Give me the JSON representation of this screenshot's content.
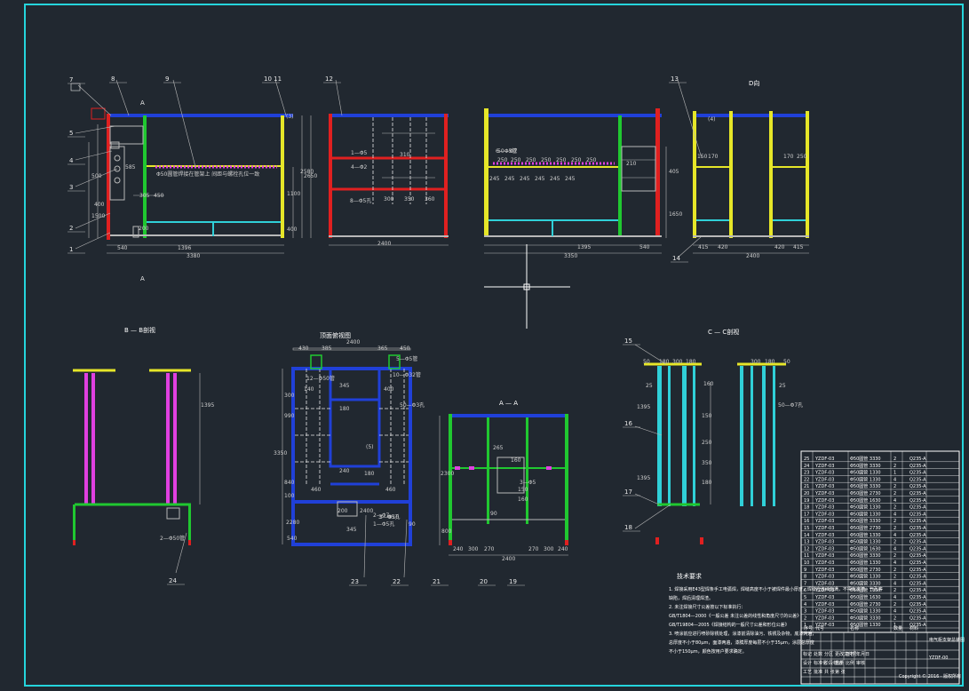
{
  "colors": {
    "background": "#212830",
    "border": "#25d5dc",
    "white": "#ffffff",
    "blue": "#2040d8",
    "red": "#e02020",
    "yellow": "#e6e628",
    "green": "#20c830",
    "cyan": "#30d0d8",
    "magenta": "#e040e0",
    "grey": "#b8b8b8"
  },
  "icons": [
    "crosshair-cursor-icon"
  ],
  "view_titles": {
    "section_b": "B — B剖视",
    "top_view_plan": "顶面俯视图",
    "section_a": "A — A",
    "section_c": "C — C剖视",
    "view_d": "D向",
    "notes_title": "技术要求"
  },
  "cut_marks": [
    "A",
    "A"
  ],
  "part_numbers": [
    "7",
    "8",
    "9",
    "10 11",
    "12",
    "13",
    "5",
    "4",
    "3",
    "2",
    "1",
    "14",
    "15",
    "16",
    "17",
    "18",
    "24",
    "23",
    "22",
    "21",
    "20",
    "19"
  ],
  "dimensions": {
    "front": [
      "540",
      "1396",
      "3380",
      "305",
      "450",
      "200",
      "500",
      "1100",
      "2580",
      "400",
      "1500",
      "400",
      "585"
    ],
    "side": [
      "2400",
      "2650",
      "300",
      "350",
      "360",
      "310"
    ],
    "rear": [
      "3350",
      "1395",
      "540",
      "210",
      "405",
      "1650",
      "245",
      "245",
      "245",
      "245",
      "245",
      "245",
      "250",
      "250",
      "250",
      "250",
      "250",
      "250",
      "250"
    ],
    "d_view": [
      "415",
      "420",
      "2400",
      "420",
      "415",
      "150",
      "170",
      "170",
      "250"
    ],
    "b_view": [
      "1395"
    ],
    "top": [
      "2400",
      "430",
      "385",
      "365",
      "450",
      "345",
      "180",
      "240",
      "460",
      "180",
      "460",
      "3350",
      "990",
      "840",
      "300",
      "100",
      "2280",
      "540",
      "200",
      "2400",
      "345",
      "140",
      "400",
      "90"
    ],
    "aa": [
      "2300",
      "240",
      "300",
      "270",
      "270",
      "300",
      "240",
      "2400",
      "265",
      "150",
      "160",
      "160",
      "800",
      "90"
    ],
    "cc": [
      "50",
      "180",
      "300",
      "180",
      "25",
      "160",
      "300",
      "180",
      "50",
      "25",
      "1395",
      "1395",
      "150",
      "250",
      "350",
      "180"
    ]
  },
  "annotations": [
    "12—Φ50管",
    "2—Φ50管",
    "2—Φ7",
    "8—Φ5孔",
    "6—Φ5管",
    "5—Φ5管",
    "10—Φ32管",
    "1—Φ5",
    "3—Φ10",
    "50—Φ7",
    "3—Φ5",
    "4—Φ2",
    "50—Φ3孔",
    "50—Φ7孔",
    "3—Φ5孔",
    "1—Φ5孔",
    "(3)",
    "(4)",
    "(5)"
  ],
  "magenta_note": "Φ50圆管焊接在管架上 间距与螺栓孔位一致",
  "bom_rows": [
    {
      "no": "25",
      "code": "YZDF-03",
      "name": "Φ50圆管 3330",
      "qty": "2",
      "mat": "Q235-A"
    },
    {
      "no": "24",
      "code": "YZDF-03",
      "name": "Φ50圆管 3330",
      "qty": "2",
      "mat": "Q235-A"
    },
    {
      "no": "23",
      "code": "YZDF-03",
      "name": "Φ50圆管 1330",
      "qty": "1",
      "mat": "Q235-A"
    },
    {
      "no": "22",
      "code": "YZDF-03",
      "name": "Φ50圆管 1330",
      "qty": "4",
      "mat": "Q235-A"
    },
    {
      "no": "21",
      "code": "YZDF-03",
      "name": "Φ50圆管 3330",
      "qty": "2",
      "mat": "Q235-A"
    },
    {
      "no": "20",
      "code": "YZDF-03",
      "name": "Φ50圆管 2730",
      "qty": "2",
      "mat": "Q235-A"
    },
    {
      "no": "19",
      "code": "YZDF-03",
      "name": "Φ50圆管 1630",
      "qty": "4",
      "mat": "Q235-A"
    },
    {
      "no": "18",
      "code": "YZDF-03",
      "name": "Φ50圆管 1330",
      "qty": "2",
      "mat": "Q235-A"
    },
    {
      "no": "17",
      "code": "YZDF-03",
      "name": "Φ50圆管 1330",
      "qty": "4",
      "mat": "Q235-A"
    },
    {
      "no": "16",
      "code": "YZDF-03",
      "name": "Φ50圆管 3330",
      "qty": "2",
      "mat": "Q235-A"
    },
    {
      "no": "15",
      "code": "YZDF-03",
      "name": "Φ50圆管 2730",
      "qty": "2",
      "mat": "Q235-A"
    },
    {
      "no": "14",
      "code": "YZDF-03",
      "name": "Φ50圆管 1330",
      "qty": "4",
      "mat": "Q235-A"
    },
    {
      "no": "13",
      "code": "YZDF-03",
      "name": "Φ50圆管 1330",
      "qty": "2",
      "mat": "Q235-A"
    },
    {
      "no": "12",
      "code": "YZDF-03",
      "name": "Φ50圆管 1630",
      "qty": "4",
      "mat": "Q235-A"
    },
    {
      "no": "11",
      "code": "YZDF-03",
      "name": "Φ50圆管 3330",
      "qty": "2",
      "mat": "Q235-A"
    },
    {
      "no": "10",
      "code": "YZDF-03",
      "name": "Φ50圆管 1330",
      "qty": "4",
      "mat": "Q235-A"
    },
    {
      "no": "9",
      "code": "YZDF-03",
      "name": "Φ50圆管 2730",
      "qty": "2",
      "mat": "Q235-A"
    },
    {
      "no": "8",
      "code": "YZDF-03",
      "name": "Φ50圆管 1330",
      "qty": "2",
      "mat": "Q235-A"
    },
    {
      "no": "7",
      "code": "YZDF-03",
      "name": "Φ50圆管 3330",
      "qty": "4",
      "mat": "Q235-A"
    },
    {
      "no": "6",
      "code": "YZDF-03",
      "name": "Φ50圆管 1330",
      "qty": "2",
      "mat": "Q235-A"
    },
    {
      "no": "5",
      "code": "YZDF-03",
      "name": "Φ50圆管 1630",
      "qty": "4",
      "mat": "Q235-A"
    },
    {
      "no": "4",
      "code": "YZDF-03",
      "name": "Φ50圆管 2730",
      "qty": "2",
      "mat": "Q235-A"
    },
    {
      "no": "3",
      "code": "YZDF-03",
      "name": "Φ50圆管 1330",
      "qty": "4",
      "mat": "Q235-A"
    },
    {
      "no": "2",
      "code": "YZDF-03",
      "name": "Φ50圆管 3330",
      "qty": "2",
      "mat": "Q235-A"
    },
    {
      "no": "1",
      "code": "YZDF-03",
      "name": "Φ50圆管 1330",
      "qty": "1",
      "mat": "Q235-A"
    }
  ],
  "bom_header": {
    "no": "序号",
    "code": "代号",
    "name": "名称",
    "qty": "数量",
    "mat": "材料"
  },
  "title_block": {
    "cells": [
      "标记",
      "处数",
      "分区",
      "更改文件号",
      "签名",
      "年月日",
      "设计",
      "标准化",
      "阶段标记",
      "重量",
      "比例",
      "审核",
      "工艺",
      "批准",
      "共 张",
      "第 张"
    ],
    "drawing_name": "电气柜支架总装图",
    "drawing_no": "YZDF-00",
    "company": "",
    "scale_note": "Copyright © 2016 · 版权所有"
  },
  "notes": [
    "1.  焊接采用E43型焊条手工电弧焊，焊缝高度不小于被焊件最小厚度，焊缝应连续饱满，不得有夹渣、气孔等",
    "缺陷，焊后清理焊渣。",
    "2.  未注焊接尺寸公差按以下标准执行：",
    "GB/T1804—2000《一般公差 未注公差的线性和角度尺寸的公差》",
    "GB/T19804—2005《焊接结构的一般尺寸公差和形位公差》",
    "3.  喷涂前应进行喷砂除锈处理，涂漆前清除油污、铁锈及杂物，底漆两遍，",
    "总厚度不小于80μm，面漆两遍，漆膜厚度每层不小于35μm，涂层总厚度",
    "不小于150μm，颜色按用户要求确定。"
  ]
}
